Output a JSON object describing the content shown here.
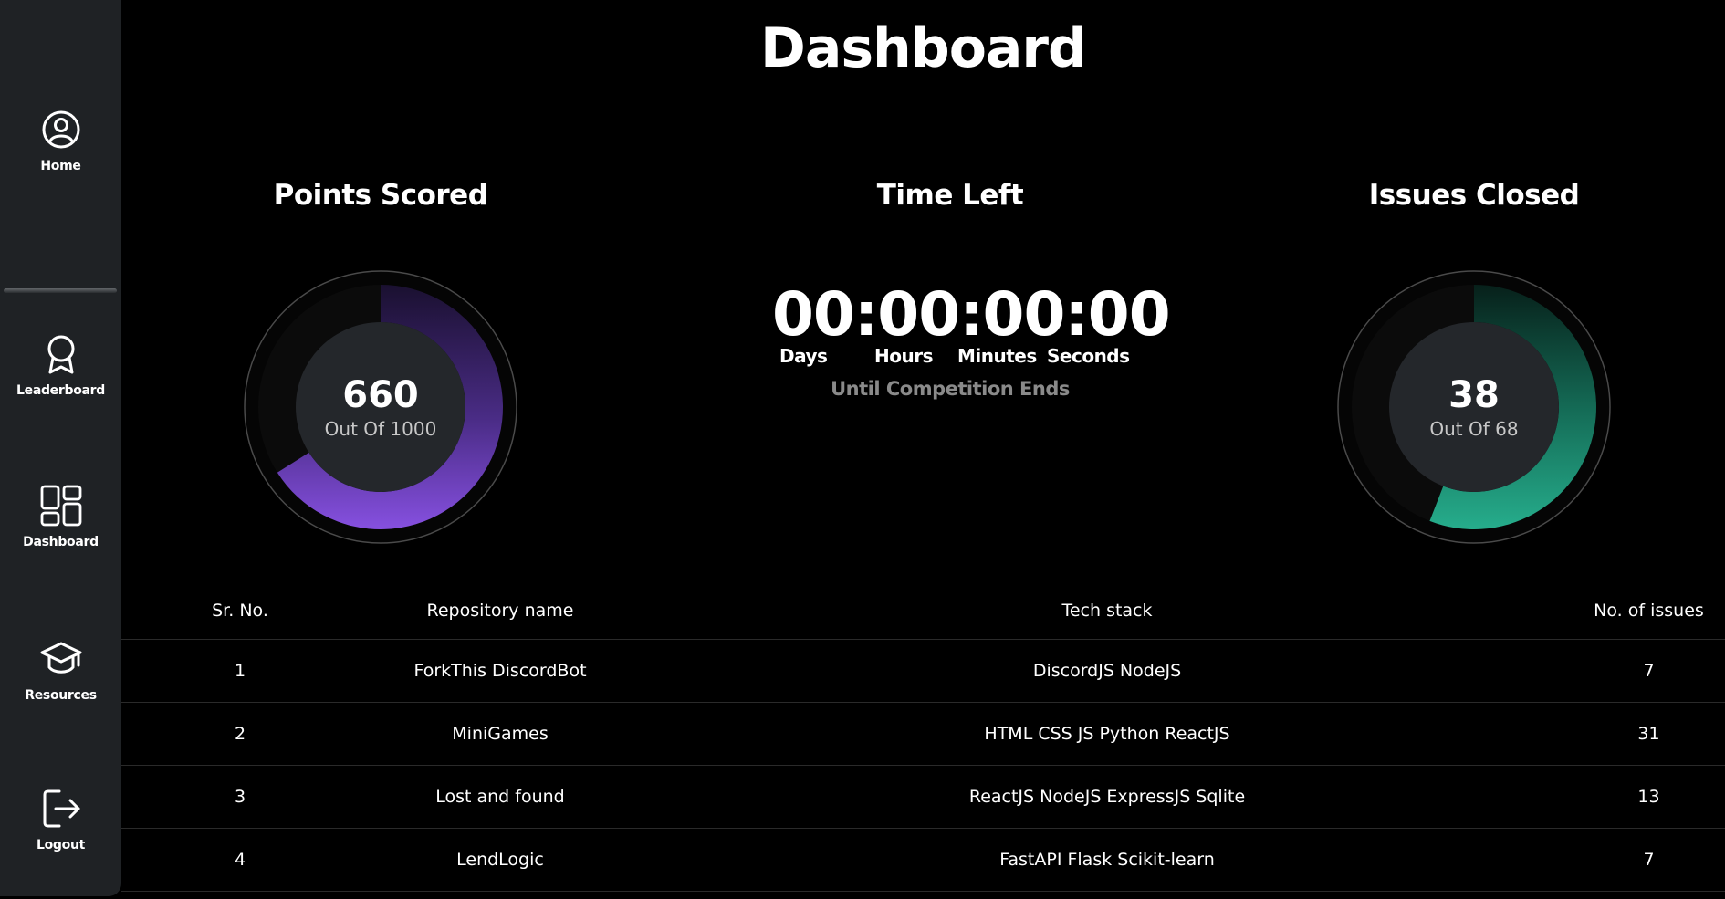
{
  "sidebar": {
    "items": [
      {
        "label": "Home",
        "icon": "user-circle-icon"
      },
      {
        "label": "Leaderboard",
        "icon": "award-icon"
      },
      {
        "label": "Dashboard",
        "icon": "grid-icon"
      },
      {
        "label": "Resources",
        "icon": "graduation-cap-icon"
      },
      {
        "label": "Logout",
        "icon": "logout-icon"
      }
    ]
  },
  "header": {
    "title": "Dashboard"
  },
  "points": {
    "title": "Points Scored",
    "value": "660",
    "subtitle": "Out Of 1000",
    "fraction": 0.66,
    "color": "#7b4fd8"
  },
  "time_left": {
    "title": "Time Left",
    "days": "00",
    "hours": "00",
    "minutes": "00",
    "seconds": "00",
    "separator": ":",
    "labels": {
      "days": "Days",
      "hours": "Hours",
      "minutes": "Minutes",
      "seconds": "Seconds"
    },
    "caption": "Until Competition Ends"
  },
  "issues": {
    "title": "Issues Closed",
    "value": "38",
    "subtitle": "Out Of 68",
    "fraction": 0.559,
    "color": "#23a98a"
  },
  "table": {
    "headers": [
      "Sr. No.",
      "Repository name",
      "Tech stack",
      "No. of issues"
    ],
    "rows": [
      [
        "1",
        "ForkThis DiscordBot",
        "DiscordJS NodeJS",
        "7"
      ],
      [
        "2",
        "MiniGames",
        "HTML CSS JS Python ReactJS",
        "31"
      ],
      [
        "3",
        "Lost and found",
        "ReactJS NodeJS ExpressJS Sqlite",
        "13"
      ],
      [
        "4",
        "LendLogic",
        "FastAPI Flask Scikit-learn",
        "7"
      ]
    ]
  }
}
